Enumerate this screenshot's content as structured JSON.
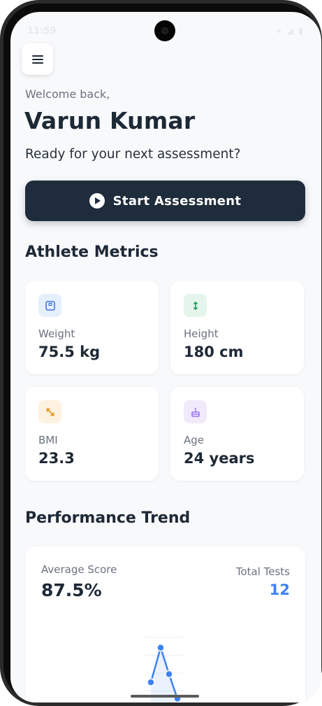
{
  "status_bar": {
    "time": "11:59",
    "icons": "▾ ◢ ▮"
  },
  "header": {
    "menu_icon": "hamburger-icon",
    "welcome": "Welcome back,",
    "name": "Varun Kumar",
    "subtitle": "Ready for your next assessment?"
  },
  "cta": {
    "label": "Start Assessment",
    "icon": "play-circle-icon",
    "background": "#1f2c3b"
  },
  "metrics": {
    "title": "Athlete Metrics",
    "items": [
      {
        "label": "Weight",
        "value": "75.5 kg",
        "icon": "scale-icon",
        "icon_bg": "#e6f0fc",
        "icon_color": "#3b6fd8"
      },
      {
        "label": "Height",
        "value": "180 cm",
        "icon": "vertical-arrows-icon",
        "icon_bg": "#e4f6ec",
        "icon_color": "#1e9e5a"
      },
      {
        "label": "BMI",
        "value": "23.3",
        "icon": "diagonal-arrows-icon",
        "icon_bg": "#fdf1e0",
        "icon_color": "#e69522"
      },
      {
        "label": "Age",
        "value": "24 years",
        "icon": "cake-icon",
        "icon_bg": "#f0eafa",
        "icon_color": "#8b5cf6"
      }
    ]
  },
  "trend": {
    "title": "Performance Trend",
    "average_label": "Average Score",
    "average_value": "87.5%",
    "total_label": "Total Tests",
    "total_value": "12",
    "accent": "#3b82f6"
  },
  "chart_data": {
    "type": "line",
    "title": "",
    "xlabel": "",
    "ylabel": "",
    "x": [
      1,
      2,
      3,
      4
    ],
    "series": [
      {
        "values": [
          78,
          95,
          82,
          70
        ]
      }
    ],
    "ylim": [
      65,
      100
    ],
    "grid": true
  }
}
